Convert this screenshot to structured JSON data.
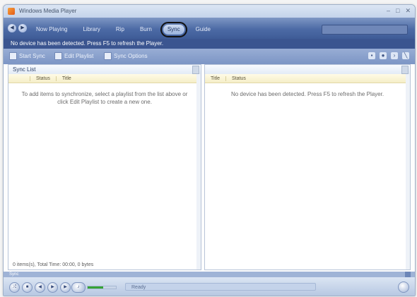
{
  "window": {
    "title": "Windows Media Player"
  },
  "nav": {
    "tabs": [
      {
        "label": "Now Playing"
      },
      {
        "label": "Library"
      },
      {
        "label": "Rip"
      },
      {
        "label": "Burn"
      },
      {
        "label": "Sync"
      },
      {
        "label": "Guide"
      }
    ],
    "active_tab": "Sync"
  },
  "banner": {
    "text": "No device has been detected. Press F5 to refresh the Player."
  },
  "toolbar": {
    "items": [
      {
        "label": "Start Sync",
        "icon": "sync-icon"
      },
      {
        "label": "Edit Playlist",
        "icon": "playlist-icon"
      },
      {
        "label": "Sync Options",
        "icon": "options-icon"
      }
    ],
    "right_icons": [
      "device-icon",
      "media-icon",
      "arrow-icon",
      "stop-icon"
    ]
  },
  "left_pane": {
    "title": "Sync List",
    "columns": [
      "",
      "Status",
      "Title"
    ],
    "message": "To add items to synchronize, select a playlist from the list above or click Edit Playlist to create a new one.",
    "status": "0 items(s), Total Time: 00:00, 0 bytes"
  },
  "right_pane": {
    "columns": [
      "Title",
      "Status"
    ],
    "message": "No device has been detected. Press F5 to refresh the Player."
  },
  "sync_bar": {
    "label": "Sync"
  },
  "player": {
    "progress": 0.55,
    "now_playing": "Ready",
    "colors": {
      "accent": "#35a335",
      "chrome": "#4c6aa5"
    }
  }
}
